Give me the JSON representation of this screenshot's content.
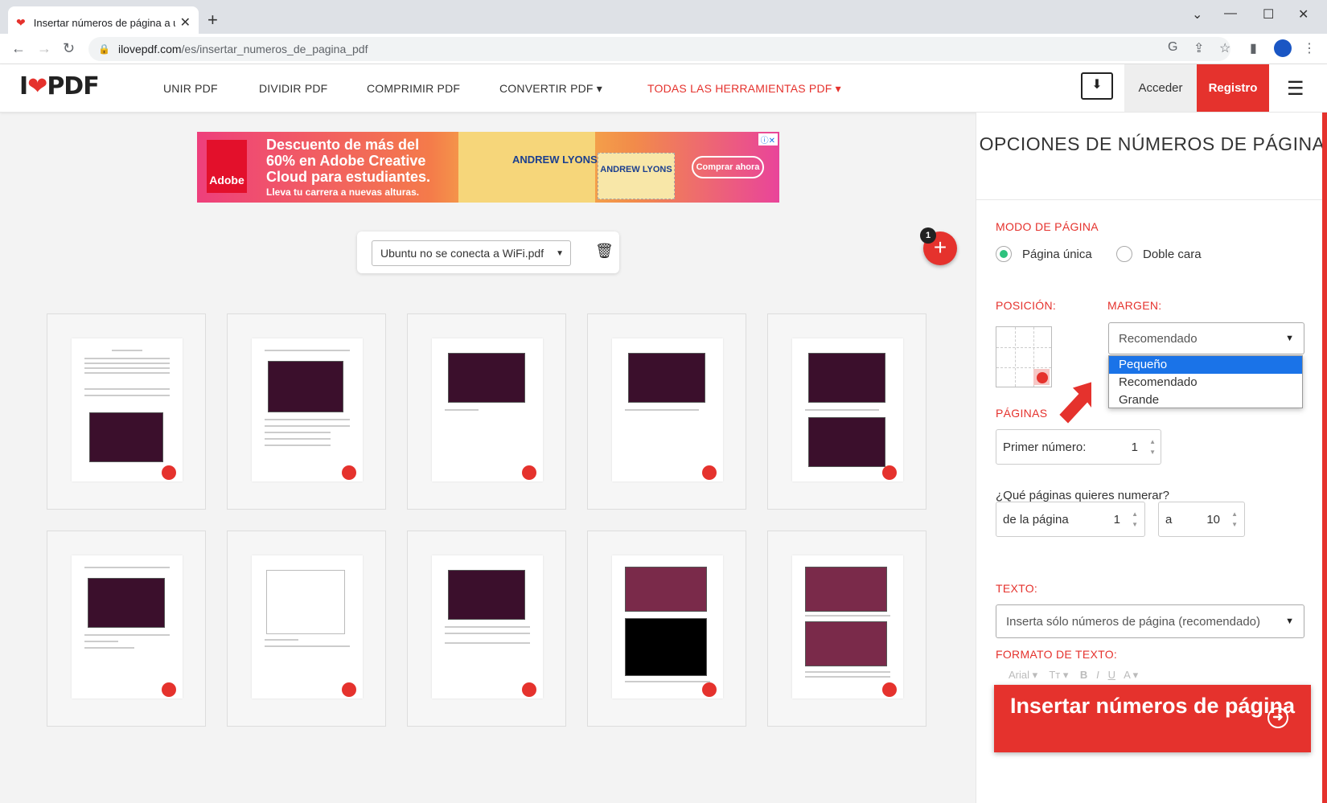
{
  "browser": {
    "tab_title": "Insertar números de página a un",
    "url_domain": "ilovepdf.com",
    "url_path": "/es/insertar_numeros_de_pagina_pdf"
  },
  "header": {
    "logo_left": "I",
    "logo_right": "PDF",
    "nav": [
      "UNIR PDF",
      "DIVIDIR PDF",
      "COMPRIMIR PDF",
      "CONVERTIR PDF ▾",
      "TODAS LAS HERRAMIENTAS PDF ▾"
    ],
    "login": "Acceder",
    "signup": "Registro",
    "accent": "#e5322d"
  },
  "ad": {
    "brand": "Adobe",
    "headline": "Descuento de más del 60% en Adobe Creative Cloud para estudiantes.",
    "sub": "Lleva tu carrera a nuevas alturas.",
    "name": "ANDREW LYONS",
    "card": "ANDREW LYONS",
    "cta": "Comprar ahora"
  },
  "file": {
    "name": "Ubuntu no se conecta a WiFi.pdf",
    "count_badge": "1"
  },
  "options": {
    "title": "OPCIONES DE NÚMEROS DE PÁGINA",
    "page_mode_label": "MODO DE PÁGINA",
    "single": "Página única",
    "double": "Doble cara",
    "position_label": "POSICIÓN:",
    "margin_label": "MARGEN:",
    "margin_value": "Recomendado",
    "margin_options": [
      "Pequeño",
      "Recomendado",
      "Grande"
    ],
    "pages_label": "PÁGINAS",
    "first_number_label": "Primer número:",
    "first_number": "1",
    "which_pages": "¿Qué páginas quieres numerar?",
    "from_label": "de la página",
    "from_value": "1",
    "to_label": "a",
    "to_value": "10",
    "text_label": "TEXTO:",
    "text_value": "Inserta sólo números de página (recomendado)",
    "format_label": "FORMATO DE TEXTO:",
    "format_font": "Arial",
    "submit": "Insertar números de página"
  }
}
